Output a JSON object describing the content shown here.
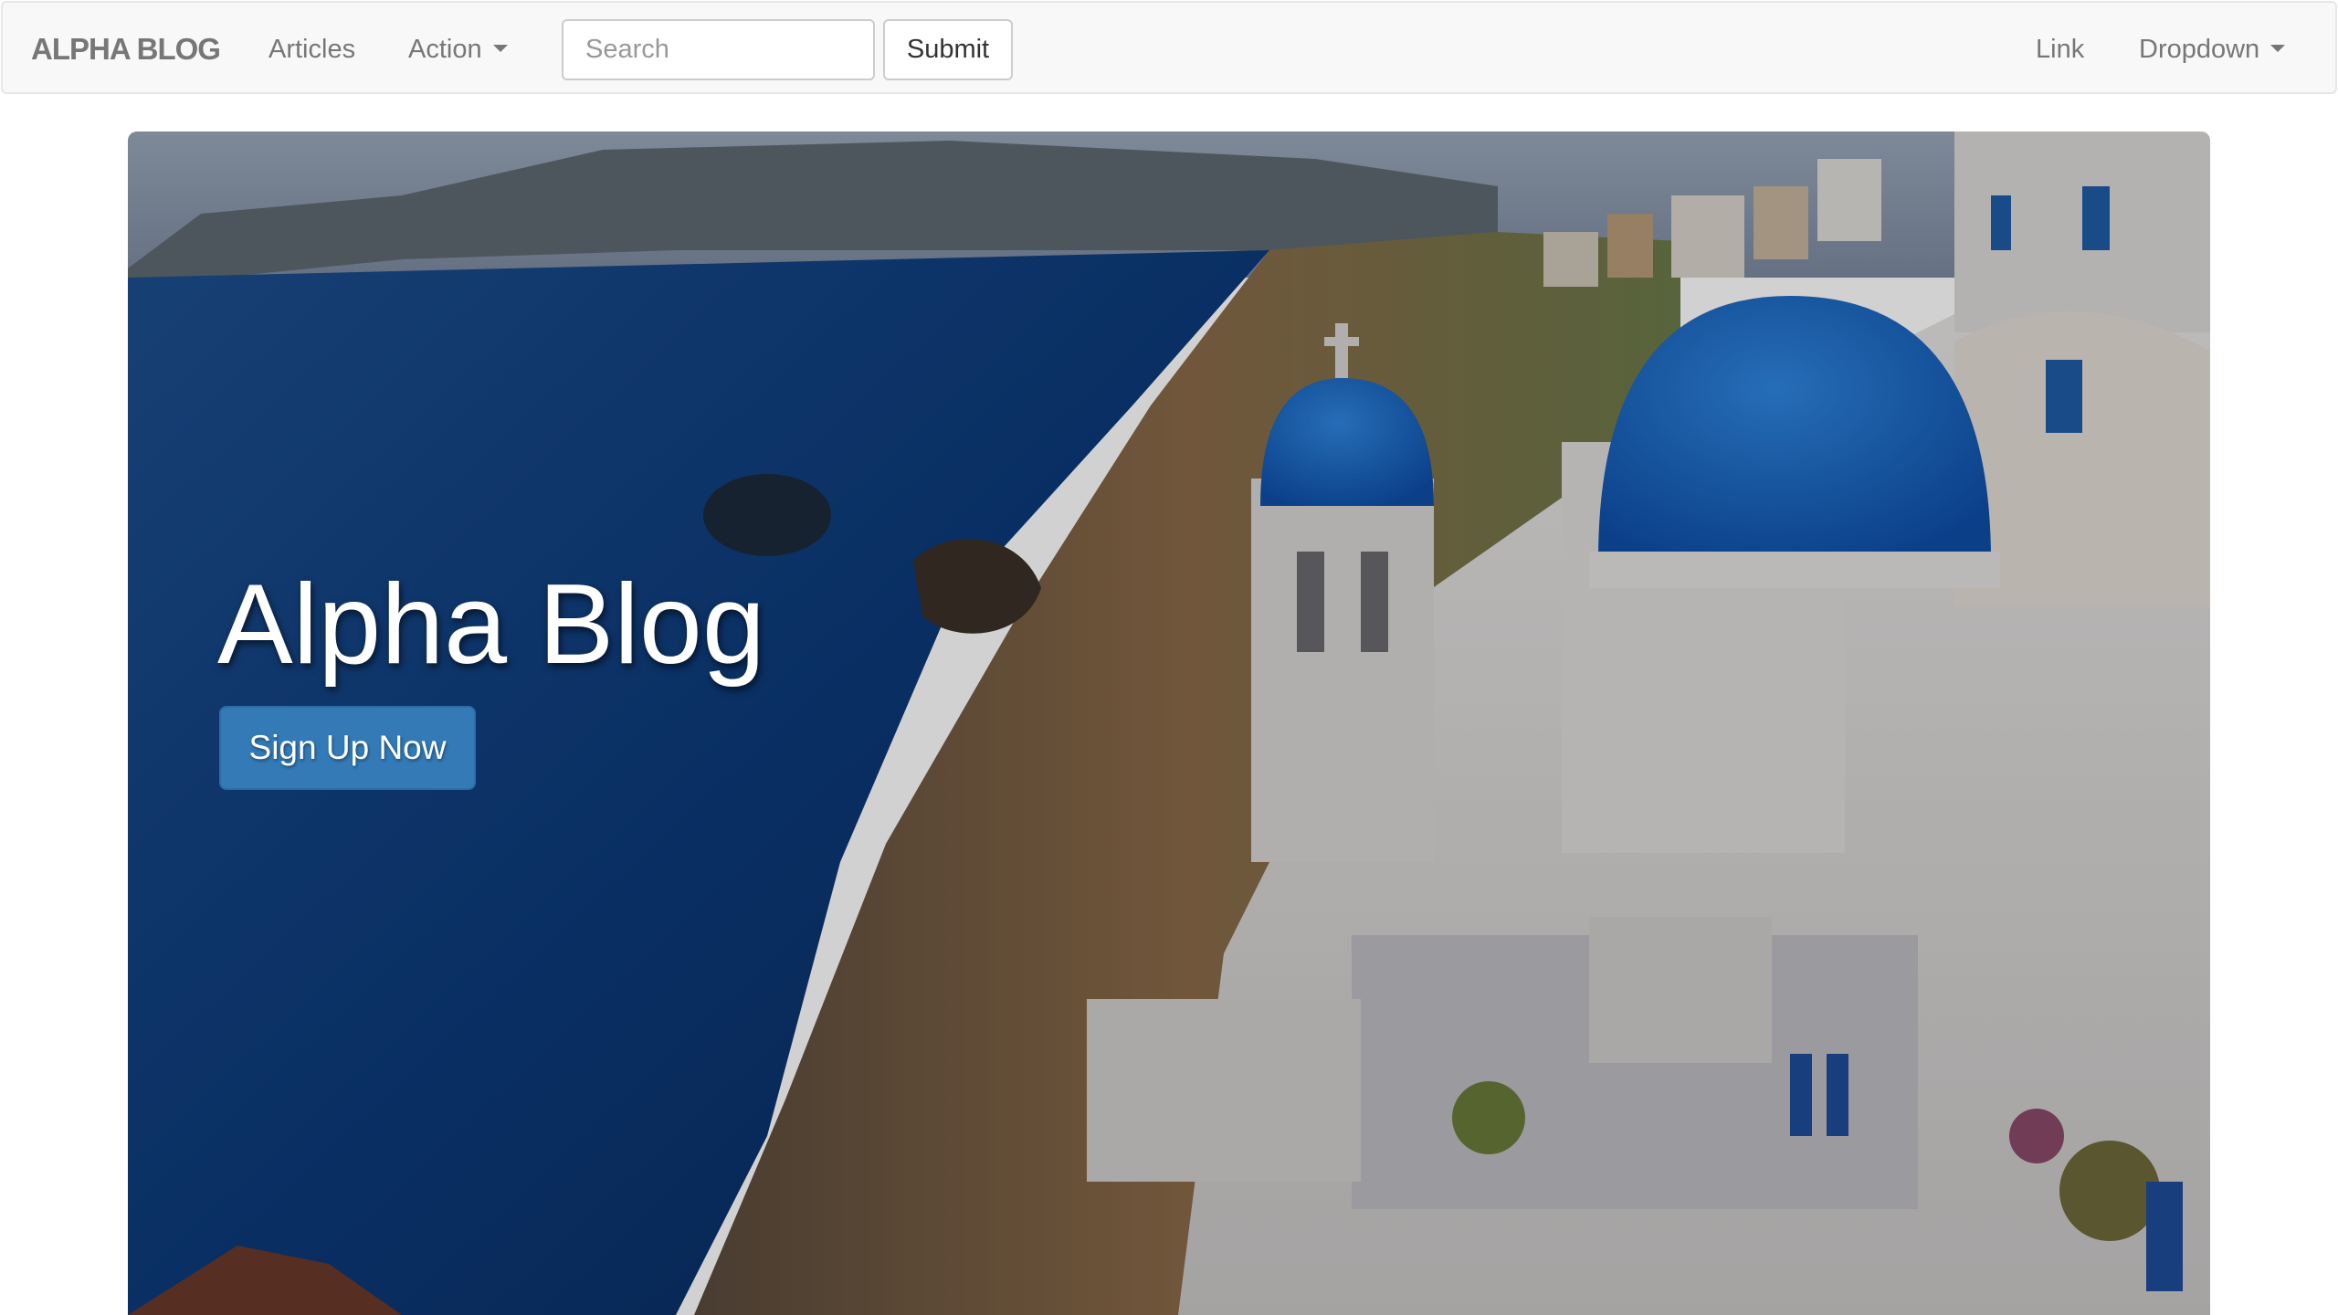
{
  "navbar": {
    "brand": "ALPHA BLOG",
    "items": [
      {
        "label": "Articles"
      },
      {
        "label": "Action"
      }
    ],
    "search": {
      "placeholder": "Search",
      "value": ""
    },
    "submit_label": "Submit",
    "right_items": [
      {
        "label": "Link"
      },
      {
        "label": "Dropdown"
      }
    ]
  },
  "hero": {
    "title": "Alpha Blog",
    "cta_label": "Sign Up Now",
    "image": "santorini-coastline-photo"
  },
  "colors": {
    "navbar_bg": "#f8f8f8",
    "nav_text": "#777777",
    "primary": "#337ab7",
    "sea": "#0b3a78",
    "dome": "#1466c8"
  }
}
